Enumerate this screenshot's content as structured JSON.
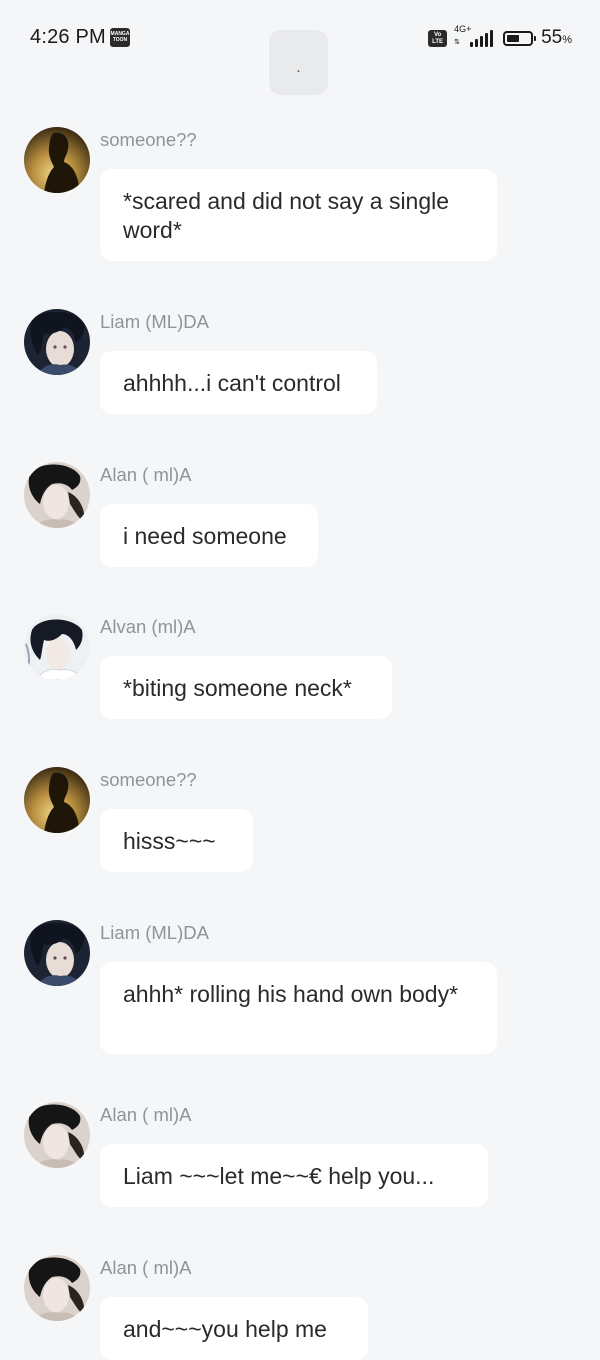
{
  "status_bar": {
    "time": "4:26 PM",
    "app_badge": "MANGA TOON",
    "volte": "Vo LTE",
    "network": "4G+",
    "battery_percent": 55,
    "battery_label": "55",
    "battery_unit": "%"
  },
  "top_pill": {
    "label": "."
  },
  "messages": [
    {
      "sender": "someone??",
      "text": "*scared and did not say a single word*",
      "avatar": "silhouette-gold"
    },
    {
      "sender": "Liam (ML)DA",
      "text": "ahhhh...i can't control",
      "avatar": "dark-hair-portrait"
    },
    {
      "sender": "Alan ( ml)A",
      "text": "i need someone",
      "avatar": "smoky-portrait"
    },
    {
      "sender": "Alvan (ml)A",
      "text": "*biting someone neck*",
      "avatar": "light-portrait"
    },
    {
      "sender": "someone??",
      "text": "hisss~~~",
      "avatar": "silhouette-gold"
    },
    {
      "sender": "Liam (ML)DA",
      "text": "ahhh* rolling his hand own body*",
      "avatar": "dark-hair-portrait"
    },
    {
      "sender": "Alan ( ml)A",
      "text": "Liam ~~~let me~~€ help you...",
      "avatar": "smoky-portrait"
    },
    {
      "sender": "Alan ( ml)A",
      "text": "and~~~you help me",
      "avatar": "smoky-portrait"
    }
  ]
}
